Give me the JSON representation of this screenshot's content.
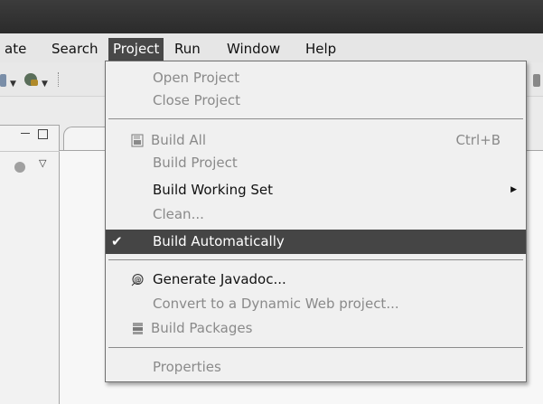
{
  "menubar": {
    "items": [
      "ate",
      "Search",
      "Project",
      "Run",
      "Window",
      "Help"
    ],
    "active": "Project"
  },
  "project_menu": {
    "items": [
      {
        "label": "Open Project",
        "enabled": false
      },
      {
        "label": "Close Project",
        "enabled": false
      },
      {
        "label": "Build All",
        "enabled": false,
        "accelerator": "Ctrl+B",
        "icon": "build-all-icon"
      },
      {
        "label": "Build Project",
        "enabled": false
      },
      {
        "label": "Build Working Set",
        "enabled": true,
        "submenu": true
      },
      {
        "label": "Clean...",
        "enabled": false
      },
      {
        "label": "Build Automatically",
        "enabled": true,
        "checked": true,
        "highlighted": true
      },
      {
        "label": "Generate Javadoc...",
        "enabled": true,
        "icon": "javadoc-icon"
      },
      {
        "label": "Convert to a Dynamic Web project...",
        "enabled": false
      },
      {
        "label": "Build Packages",
        "enabled": false,
        "icon": "build-packages-icon"
      },
      {
        "label": "Properties",
        "enabled": false
      }
    ]
  },
  "colors": {
    "menu_highlight": "#454545",
    "disabled_text": "#8a8a8a",
    "titlebar": "#2f2f2f"
  }
}
